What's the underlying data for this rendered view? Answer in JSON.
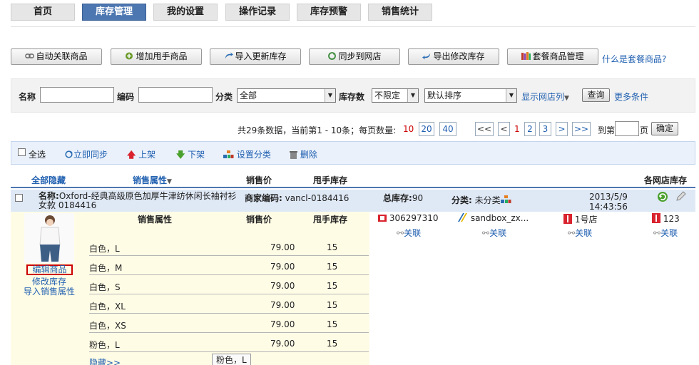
{
  "nav": {
    "tabs": [
      "首页",
      "库存管理",
      "我的设置",
      "操作记录",
      "库存预警",
      "销售统计"
    ],
    "active": "库存管理"
  },
  "toolbar": {
    "auto_link": "自动关联商品",
    "add_secondhand": "增加甩手商品",
    "import_update": "导入更新库存",
    "sync_shop": "同步到网店",
    "export_modify": "导出修改库存",
    "bundle_manage": "套餐商品管理",
    "what_is_bundle": "什么是套餐商品?"
  },
  "search": {
    "name_label": "名称",
    "code_label": "编码",
    "category_label": "分类",
    "category_value": "全部",
    "stock_label": "库存数",
    "stock_value": "不限定",
    "sort_value": "默认排序",
    "show_shop_col": "显示网店列",
    "query_button": "查询",
    "more_conditions": "更多条件"
  },
  "pager": {
    "summary": "共29条数据，当前第1 - 10条；每页数量:",
    "size_10": "10",
    "size_20": "20",
    "size_40": "40",
    "first": "<<",
    "prev": "<",
    "page1": "1",
    "page2": "2",
    "page3": "3",
    "next": ">",
    "last": ">>",
    "goto_prefix": "到第",
    "goto_suffix": "页",
    "confirm": "确定"
  },
  "actions": {
    "select_all": "全选",
    "sync_now": "立即同步",
    "list_on": "上架",
    "list_off": "下架",
    "set_category": "设置分类",
    "delete": "删除"
  },
  "table_header": {
    "hide_all": "全部隐藏",
    "sales_attr": "销售属性",
    "price": "销售价",
    "stock": "甩手库存",
    "shop_stock": "各网店库存"
  },
  "product": {
    "name_label": "名称:",
    "name_value": "Oxford-经典高级原色加厚牛津纺休闲长袖衬衫女款 0184416",
    "merchant_code_label": "商家编码:",
    "merchant_code": "vancl-0184416",
    "total_stock_label": "总库存:",
    "total_stock": "90",
    "category_label": "分类:",
    "category": "未分类",
    "date": "2013/5/9",
    "time": "14:43:56",
    "edit_product": "编辑商品",
    "modify_stock": "修改库存",
    "import_attrs": "导入销售属性",
    "sub_header": {
      "attr": "销售属性",
      "price": "销售价",
      "stock": "甩手库存"
    },
    "variants": [
      {
        "attr": "白色，L",
        "price": "79.00",
        "stock": "15"
      },
      {
        "attr": "白色，M",
        "price": "79.00",
        "stock": "15"
      },
      {
        "attr": "白色，S",
        "price": "79.00",
        "stock": "15"
      },
      {
        "attr": "白色，XL",
        "price": "79.00",
        "stock": "15"
      },
      {
        "attr": "白色，XS",
        "price": "79.00",
        "stock": "15"
      },
      {
        "attr": "粉色，L",
        "price": "79.00",
        "stock": "15"
      }
    ],
    "hide_link": "隐藏>>",
    "tooltip": "粉色，L",
    "shops": [
      {
        "name": "306297310",
        "link": "关联"
      },
      {
        "name": "sandbox_zx...",
        "link": "关联"
      },
      {
        "name": "1号店",
        "link": "关联"
      },
      {
        "name": "123",
        "link": "关联"
      }
    ]
  },
  "colors": {
    "nav_active": "#4d77b1",
    "link": "#1f5fb0",
    "highlight_red": "#cc0000"
  }
}
